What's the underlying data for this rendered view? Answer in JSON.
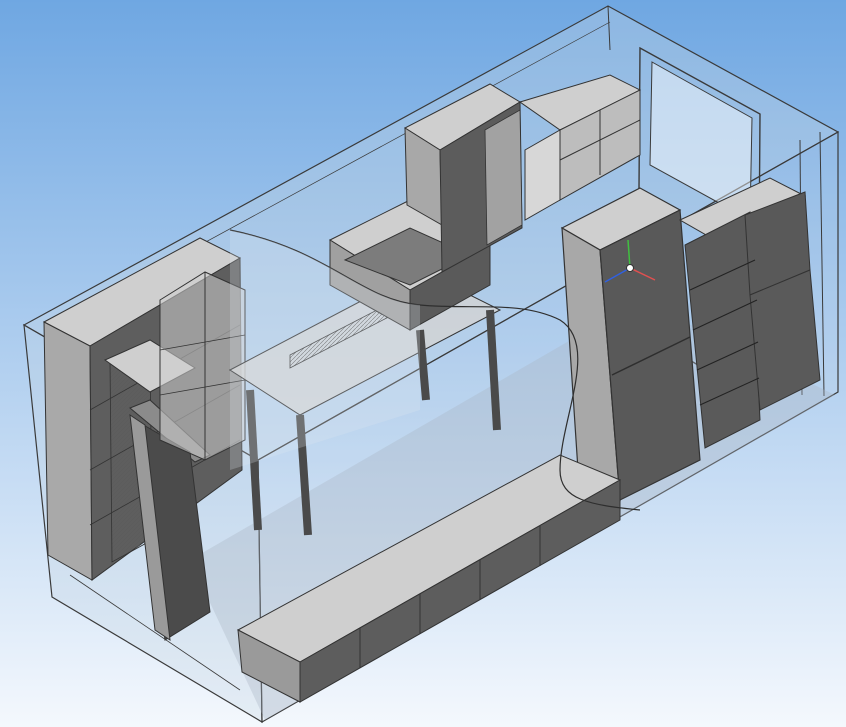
{
  "viewport": {
    "background_top": "#6fa7e2",
    "background_bottom": "#f4f8fd",
    "wireframe_color": "#3a3a3a",
    "glass_color": "#b7c7d6"
  },
  "model": {
    "face_colors": {
      "light": "#d0d0d0",
      "mid": "#a9a9a9",
      "dark": "#5a5a5a",
      "darker": "#4b4b4b"
    }
  },
  "axis_triad": {
    "x_color": "#e05050",
    "y_color": "#3060e0",
    "z_color": "#40c040",
    "icon": "coordinate-axes-icon"
  }
}
